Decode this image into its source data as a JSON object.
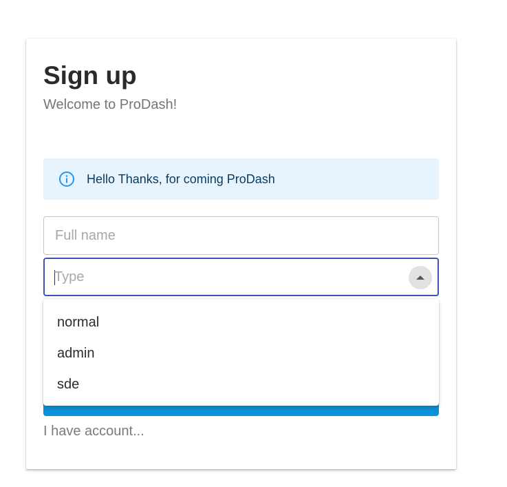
{
  "form": {
    "title": "Sign up",
    "subtitle": "Welcome to ProDash!",
    "alert": {
      "icon": "info-icon",
      "message": "Hello Thanks, for coming ProDash",
      "background": "#e8f4fd",
      "icon_color": "#2196f3"
    },
    "full_name": {
      "placeholder": "Full name",
      "value": ""
    },
    "type": {
      "placeholder": "Type",
      "value": "",
      "toggle_icon": "arrow-up-icon",
      "focused_border": "#3f51b5"
    },
    "submit_color": "#0b92d9",
    "account_link": "I have account..."
  },
  "dropdown": {
    "options": [
      "normal",
      "admin",
      "sde"
    ]
  }
}
